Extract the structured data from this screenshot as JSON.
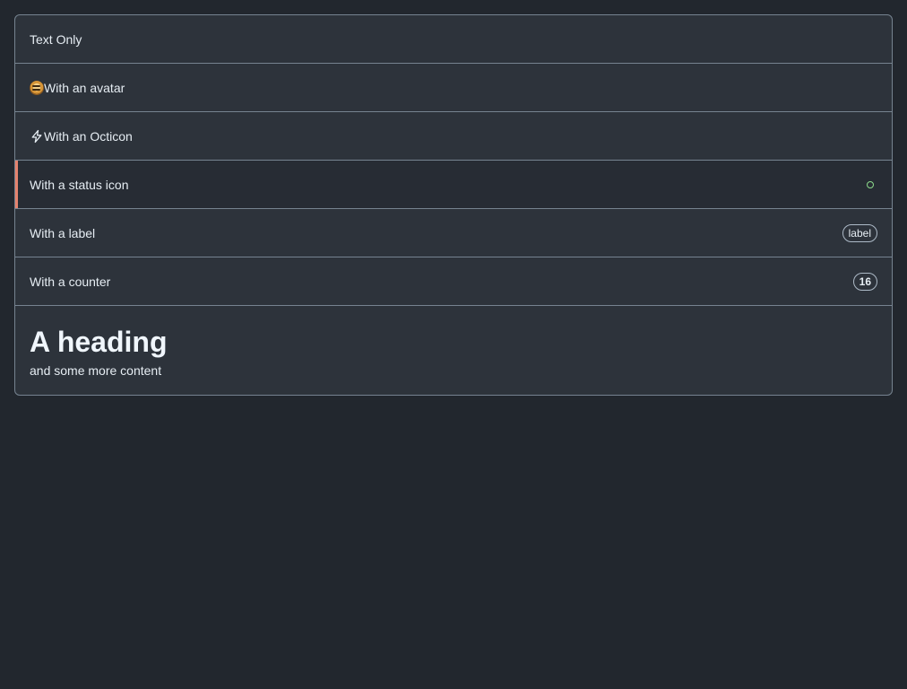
{
  "list": {
    "rows": [
      {
        "label": "Text Only"
      },
      {
        "label": "With an avatar",
        "icon": "avatar"
      },
      {
        "label": "With an Octicon",
        "icon": "zap-icon"
      },
      {
        "label": "With a status icon",
        "status_icon": "open-circle-icon",
        "accent_color": "#e5826e"
      },
      {
        "label": "With a label",
        "badge": "label"
      },
      {
        "label": "With a counter",
        "counter": "16"
      }
    ],
    "heading": "A heading",
    "content": "and some more content"
  },
  "colors": {
    "background": "#22272e",
    "box": "#2d333b",
    "border": "#768390",
    "status_green": "#8ddb8c"
  }
}
